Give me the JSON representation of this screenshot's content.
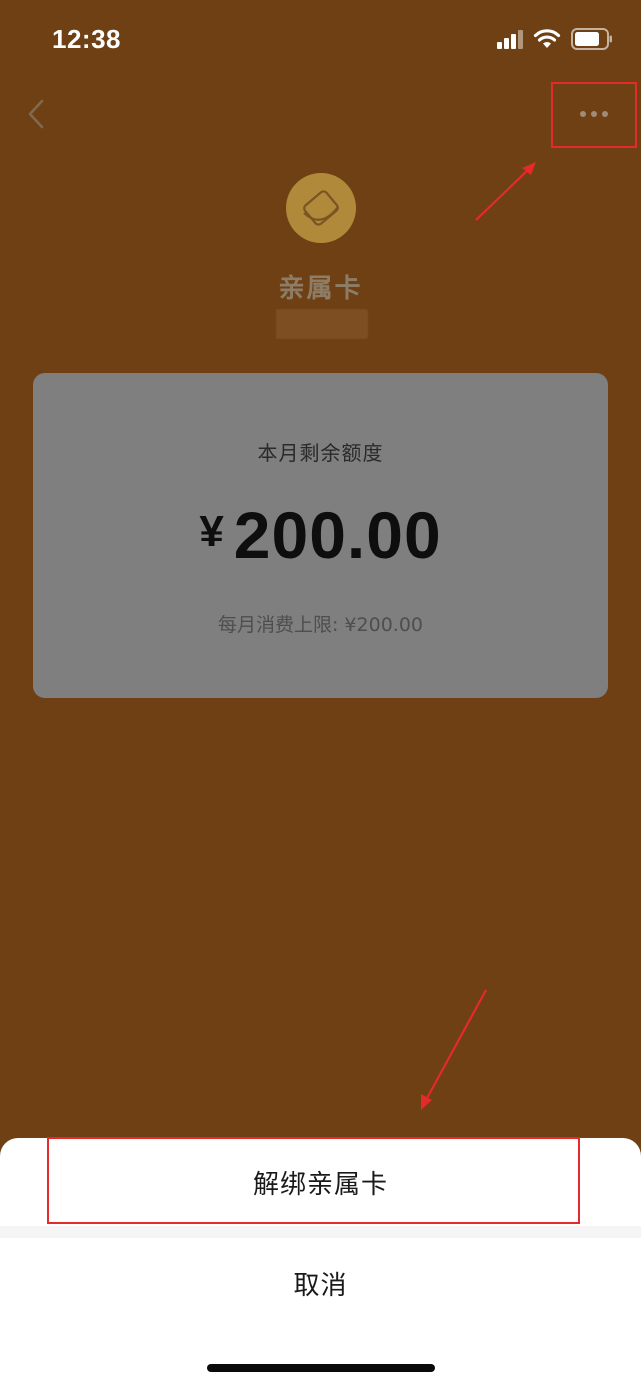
{
  "status_bar": {
    "time": "12:38",
    "icons": [
      "signal-icon",
      "wifi-icon",
      "battery-icon"
    ]
  },
  "nav": {
    "back_icon": "chevron-left-icon",
    "more_icon": "more-horizontal-icon"
  },
  "card": {
    "title": "亲属卡",
    "logo_icon": "family-card-logo-icon"
  },
  "quota": {
    "label": "本月剩余额度",
    "currency": "¥",
    "amount": "200.00",
    "limit_text": "每月消费上限: ¥200.00"
  },
  "action_sheet": {
    "unbind_label": "解绑亲属卡",
    "cancel_label": "取消"
  },
  "colors": {
    "overlay_background": "#6e4013",
    "annotation_red": "#e52a2a",
    "quota_card": "#7f7f7f"
  }
}
